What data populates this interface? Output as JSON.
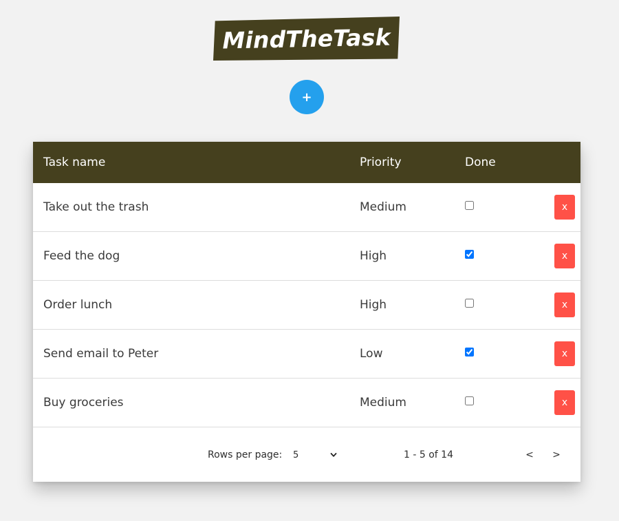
{
  "app": {
    "title": "MindTheTask",
    "add_button_label": "+"
  },
  "colors": {
    "header_bg": "#45401e",
    "add_button": "#24a0ed",
    "delete_button": "#ff5147",
    "page_bg": "#f2f2f2"
  },
  "table": {
    "columns": [
      "Task name",
      "Priority",
      "Done"
    ],
    "rows": [
      {
        "name": "Take out the trash",
        "priority": "Medium",
        "done": false,
        "delete_label": "x"
      },
      {
        "name": "Feed the dog",
        "priority": "High",
        "done": true,
        "delete_label": "x"
      },
      {
        "name": "Order lunch",
        "priority": "High",
        "done": false,
        "delete_label": "x"
      },
      {
        "name": "Send email to Peter",
        "priority": "Low",
        "done": true,
        "delete_label": "x"
      },
      {
        "name": "Buy groceries",
        "priority": "Medium",
        "done": false,
        "delete_label": "x"
      }
    ]
  },
  "pagination": {
    "rows_per_page_label": "Rows per page:",
    "rows_per_page_value": "5",
    "range_text": "1 - 5 of 14",
    "prev_label": "<",
    "next_label": ">"
  }
}
